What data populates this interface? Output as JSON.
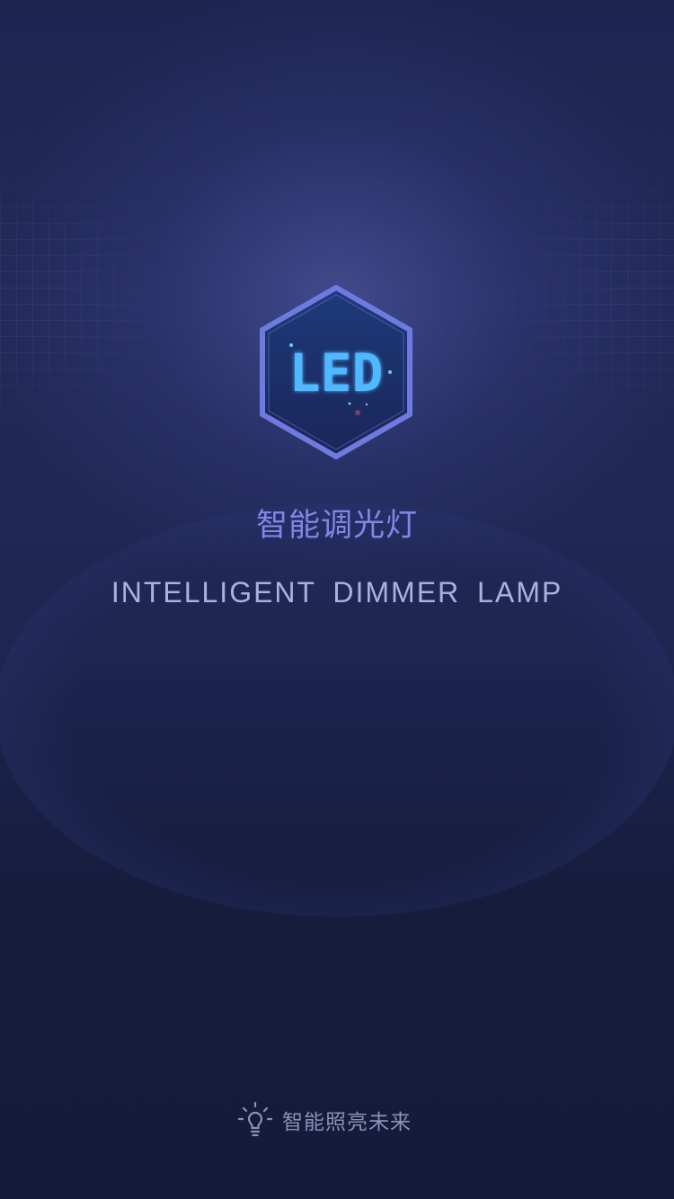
{
  "splash": {
    "logo_text": "LED",
    "title_cn": "智能调光灯",
    "title_en": "INTELLIGENT  DIMMER  LAMP",
    "slogan": "智能照亮未来",
    "logo_icon": "led-hexagon-icon",
    "slogan_icon": "light-bulb-icon"
  },
  "colors": {
    "background": "#151c3b",
    "title_cn": "#7f87e6",
    "title_en": "#aab0e4",
    "slogan": "#8b91b8",
    "logo_border": "#6f7ae0",
    "logo_text": "#4fb8ff"
  }
}
